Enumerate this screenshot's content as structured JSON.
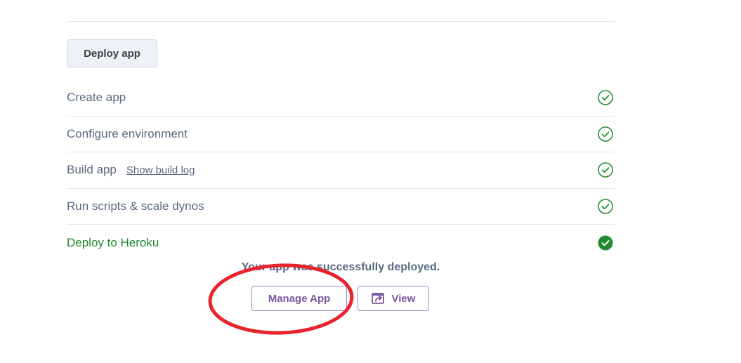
{
  "deploy_button": {
    "label": "Deploy app"
  },
  "steps": [
    {
      "label": "Create app",
      "status_icon": "check-circle-outline",
      "status": "complete"
    },
    {
      "label": "Configure environment",
      "status_icon": "check-circle-outline",
      "status": "complete"
    },
    {
      "label": "Build app",
      "link": "Show build log",
      "status_icon": "check-circle-outline",
      "status": "complete"
    },
    {
      "label": "Run scripts & scale dynos",
      "status_icon": "check-circle-outline",
      "status": "complete"
    },
    {
      "label": "Deploy to Heroku",
      "status_icon": "check-circle-filled",
      "status": "success"
    }
  ],
  "result": {
    "message": "Your app was successfully deployed.",
    "manage_label": "Manage App",
    "view_label": "View",
    "view_icon": "external-link-icon"
  },
  "colors": {
    "success_green": "#1f8a2e",
    "brand_purple": "#79589f",
    "annotation_red": "#e8232b"
  }
}
